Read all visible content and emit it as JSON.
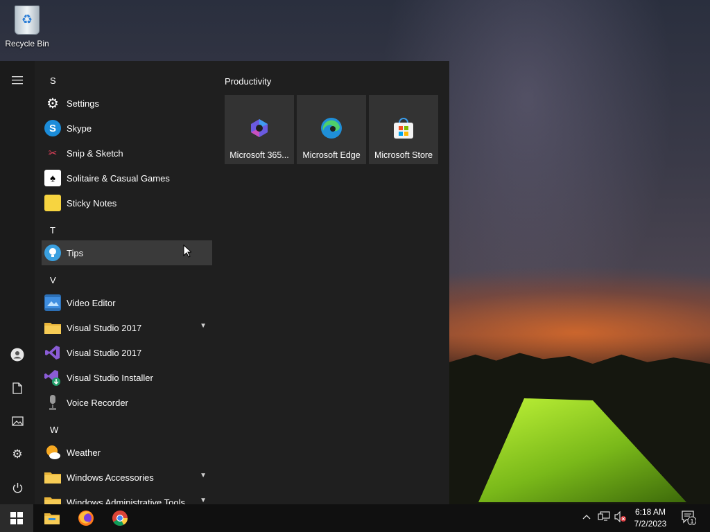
{
  "desktop": {
    "icons": [
      {
        "label": "Recycle Bin",
        "icon": "recycle-bin-icon"
      }
    ]
  },
  "start_menu": {
    "rail": {
      "top": [
        {
          "icon": "hamburger-menu-icon"
        }
      ],
      "bottom": [
        {
          "icon": "user-icon"
        },
        {
          "icon": "documents-icon"
        },
        {
          "icon": "pictures-icon"
        },
        {
          "icon": "settings-icon"
        },
        {
          "icon": "power-icon"
        }
      ]
    },
    "letters": [
      "S",
      "T",
      "V",
      "W"
    ],
    "apps": [
      {
        "label": "Settings",
        "icon": "gear-icon"
      },
      {
        "label": "Skype",
        "icon": "skype-icon"
      },
      {
        "label": "Snip & Sketch",
        "icon": "snip-sketch-icon"
      },
      {
        "label": "Solitaire & Casual Games",
        "icon": "solitaire-icon"
      },
      {
        "label": "Sticky Notes",
        "icon": "sticky-notes-icon"
      },
      {
        "label": "Tips",
        "icon": "tips-icon"
      },
      {
        "label": "Video Editor",
        "icon": "video-editor-icon"
      },
      {
        "label": "Visual Studio 2017",
        "icon": "folder-icon",
        "expandable": true
      },
      {
        "label": "Visual Studio 2017",
        "icon": "visual-studio-icon"
      },
      {
        "label": "Visual Studio Installer",
        "icon": "visual-studio-installer-icon"
      },
      {
        "label": "Voice Recorder",
        "icon": "microphone-icon"
      },
      {
        "label": "Weather",
        "icon": "weather-icon"
      },
      {
        "label": "Windows Accessories",
        "icon": "folder-icon",
        "expandable": true
      },
      {
        "label": "Windows Administrative Tools",
        "icon": "folder-icon",
        "expandable": true
      }
    ],
    "hovered_app": "Tips",
    "tiles_group": "Productivity",
    "tiles": [
      {
        "label": "Microsoft 365...",
        "icon": "microsoft-365-icon"
      },
      {
        "label": "Microsoft Edge",
        "icon": "edge-icon"
      },
      {
        "label": "Microsoft Store",
        "icon": "store-icon"
      }
    ]
  },
  "taskbar": {
    "start_icon": "windows-logo-icon",
    "pinned": [
      {
        "icon": "file-explorer-icon"
      },
      {
        "icon": "firefox-icon"
      },
      {
        "icon": "chrome-icon"
      }
    ],
    "tray": {
      "icons": [
        "chevron-up-icon",
        "network-icon",
        "volume-muted-icon"
      ],
      "time": "6:18 AM",
      "date": "7/2/2023",
      "notifications_count": "1"
    }
  },
  "colors": {
    "start_bg": "#1f1f1f",
    "tile_bg": "#333333",
    "hover_bg": "#3a3a3a",
    "taskbar_bg": "#101010"
  }
}
